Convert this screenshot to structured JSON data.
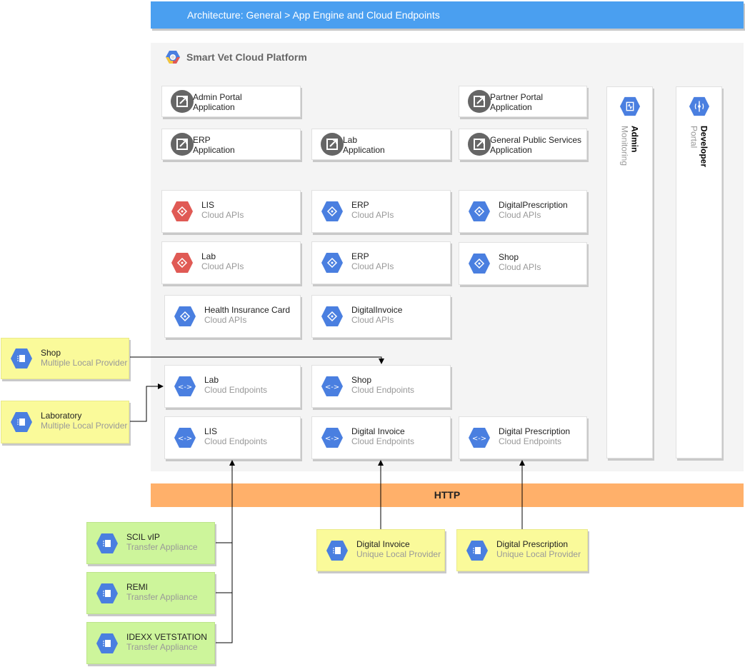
{
  "header": {
    "title": "Architecture: General > App Engine and Cloud Endpoints"
  },
  "platform": {
    "title": "Smart Vet Cloud Platform"
  },
  "applications": [
    {
      "name": "Admin Portal",
      "type": "Application"
    },
    {
      "name": "Partner Portal",
      "type": "Application"
    },
    {
      "name": "ERP",
      "type": "Application"
    },
    {
      "name": "Lab",
      "type": "Application"
    },
    {
      "name": "General Public Services",
      "type": "Application"
    }
  ],
  "cloud_apis": [
    {
      "name": "LIS",
      "type": "Cloud APIs",
      "color": "red"
    },
    {
      "name": "ERP",
      "type": "Cloud APIs",
      "color": "blue"
    },
    {
      "name": "DigitalPrescription",
      "type": "Cloud APIs",
      "color": "blue"
    },
    {
      "name": "Lab",
      "type": "Cloud APIs",
      "color": "red"
    },
    {
      "name": "ERP",
      "type": "Cloud APIs",
      "color": "blue"
    },
    {
      "name": "Shop",
      "type": "Cloud APIs",
      "color": "blue"
    },
    {
      "name": "Health Insurance Card",
      "type": "Cloud APIs",
      "color": "blue"
    },
    {
      "name": "DigitalInvoice",
      "type": "Cloud APIs",
      "color": "blue"
    }
  ],
  "endpoints": [
    {
      "name": "Lab",
      "type": "Cloud Endpoints"
    },
    {
      "name": "Shop",
      "type": "Cloud Endpoints"
    },
    {
      "name": "LIS",
      "type": "Cloud Endpoints"
    },
    {
      "name": "Digital Invoice",
      "type": "Cloud Endpoints"
    },
    {
      "name": "Digital Prescription",
      "type": "Cloud Endpoints"
    }
  ],
  "side_panels": [
    {
      "name": "Admin",
      "type": "Monitoring"
    },
    {
      "name": "Developer",
      "type": "Portal"
    }
  ],
  "http": {
    "label": "HTTP"
  },
  "local_providers": [
    {
      "name": "Shop",
      "type": "Multiple Local Provider"
    },
    {
      "name": "Laboratory",
      "type": "Multiple Local Provider"
    },
    {
      "name": "Digital Invoice",
      "type": "Unique Local Provider"
    },
    {
      "name": "Digital Prescription",
      "type": "Unique Local Provider"
    }
  ],
  "transfer_appliances": [
    {
      "name": "SCIL vIP",
      "type": "Transfer Appliance"
    },
    {
      "name": "REMI",
      "type": "Transfer Appliance"
    },
    {
      "name": "IDEXX VETSTATION",
      "type": "Transfer Appliance"
    }
  ],
  "colors": {
    "header": "#4a9ff0",
    "http": "#ffb06a",
    "gcp_blue": "#4a7fe0",
    "gcp_red": "#e05a55",
    "app_gray": "#666666",
    "yellow_box": "#fafa9a",
    "green_box": "#cdf59b"
  }
}
